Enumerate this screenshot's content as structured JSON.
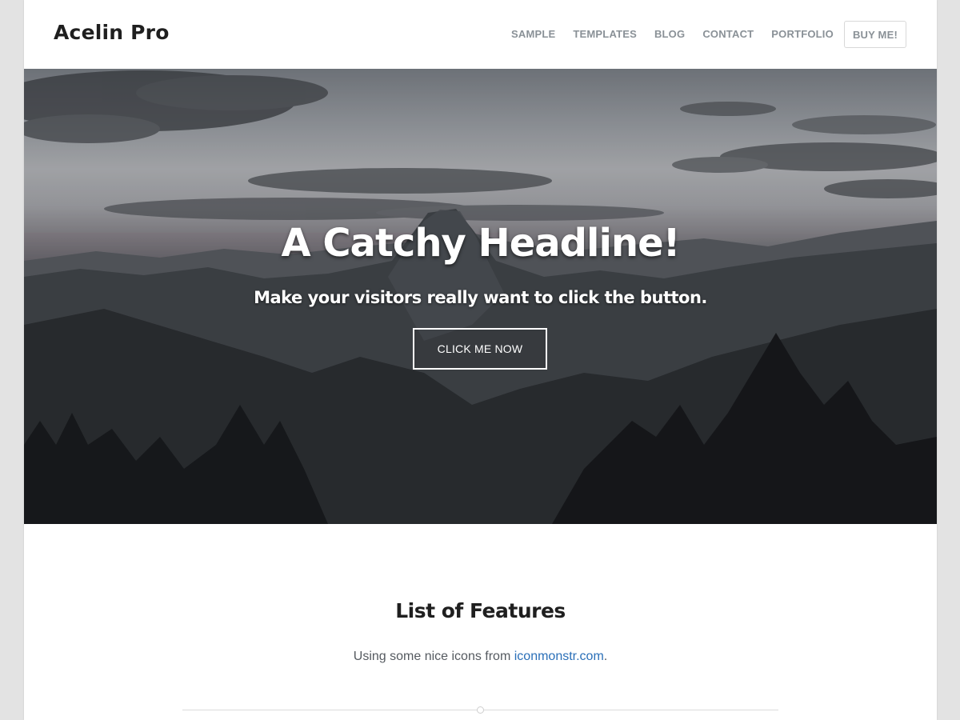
{
  "site": {
    "title": "Acelin Pro"
  },
  "nav": {
    "items": [
      {
        "label": "SAMPLE"
      },
      {
        "label": "TEMPLATES"
      },
      {
        "label": "BLOG"
      },
      {
        "label": "CONTACT"
      },
      {
        "label": "PORTFOLIO"
      }
    ],
    "buy_label": "BUY ME!"
  },
  "hero": {
    "headline": "A Catchy Headline!",
    "subheadline": "Make your visitors really want to click the button.",
    "button_label": "CLICK ME NOW"
  },
  "features": {
    "title": "List of Features",
    "subtitle_prefix": "Using some nice icons from ",
    "link_text": "iconmonstr.com",
    "subtitle_suffix": "."
  },
  "colors": {
    "accent_link": "#2a6fb8",
    "nav_text": "#8a9197",
    "page_bg": "#e3e3e3"
  }
}
